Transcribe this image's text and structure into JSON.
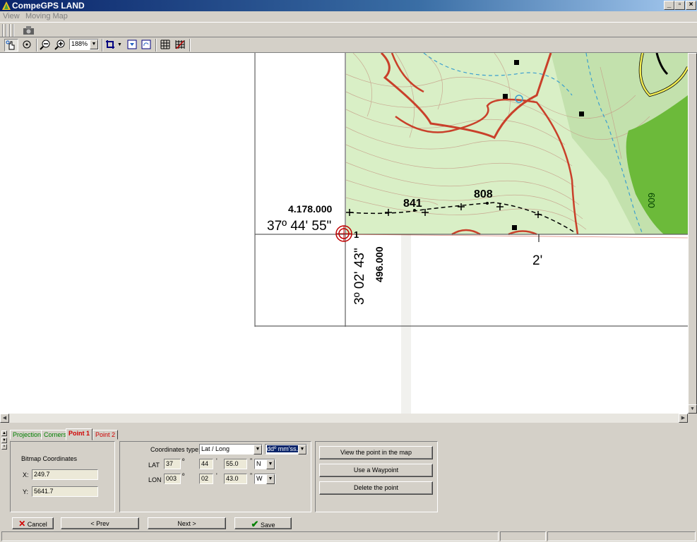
{
  "window": {
    "title": "CompeGPS LAND"
  },
  "menu": {
    "items": [
      "View",
      "Moving Map"
    ]
  },
  "toolbar": {
    "zoom": "188%"
  },
  "map": {
    "northing_label": "4.178.000",
    "lat_label": "37º 44' 55\"",
    "lon_label": "3º 02' 43\"",
    "easting_label": "496.000",
    "elev_label_1": "841",
    "elev_label_2": "808",
    "point_number": "1",
    "minute_label": "2'",
    "contour_label": "600"
  },
  "tabs": [
    {
      "label": "Projection"
    },
    {
      "label": "Corners"
    },
    {
      "label": "Point 1"
    },
    {
      "label": "Point 2"
    }
  ],
  "bitmap": {
    "title": "Bitmap Coordinates",
    "x_label": "X:",
    "x_value": "249.7",
    "y_label": "Y:",
    "y_value": "5641.7"
  },
  "coords": {
    "type_label": "Coordinates type:",
    "type_value": "Lat / Long",
    "format_value": "ddº mm'ss.s",
    "lat": {
      "label": "LAT",
      "deg": "37",
      "min": "44",
      "sec": "55.0",
      "hemi": "N"
    },
    "lon": {
      "label": "LON",
      "deg": "003",
      "min": "02",
      "sec": "43.0",
      "hemi": "W"
    },
    "deg_sym": "º",
    "min_sym": "'",
    "sec_sym": "\""
  },
  "point_actions": {
    "view_label": "View the point in the map",
    "waypoint_label": "Use a Waypoint",
    "delete_label": "Delete the point"
  },
  "footer": {
    "cancel_label": "Cancel",
    "prev_label": "< Prev",
    "next_label": "Next >",
    "save_label": "Save"
  },
  "colors": {
    "title_active": "#0a246a",
    "map_green": "#d9efc6",
    "contour_red": "#c9402a",
    "road_yellow": "#f2ee55",
    "forest_green": "#6cba3a",
    "stream_blue": "#3b9fcf",
    "tab_green": "#008000",
    "tab_red": "#d00000"
  }
}
